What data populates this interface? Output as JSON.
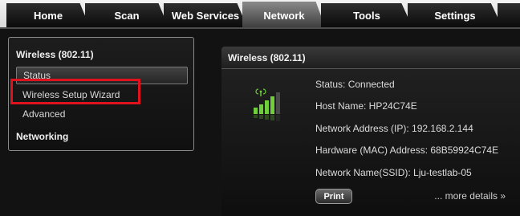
{
  "tabs": [
    {
      "label": "Home"
    },
    {
      "label": "Scan"
    },
    {
      "label": "Web Services"
    },
    {
      "label": "Network",
      "active": true
    },
    {
      "label": "Tools"
    },
    {
      "label": "Settings"
    }
  ],
  "sidebar": {
    "wireless_heading": "Wireless (802.11)",
    "items": [
      {
        "label": "Status",
        "selected": true
      },
      {
        "label": "Wireless Setup Wizard",
        "highlighted": true
      },
      {
        "label": "Advanced"
      }
    ],
    "networking_heading": "Networking"
  },
  "main": {
    "title": "Wireless (802.11)",
    "status": "Status: Connected",
    "host_name": "Host Name: HP24C74E",
    "ip_address": "Network Address (IP): 192.168.2.144",
    "mac_address": "Hardware (MAC) Address: 68B59924C74E",
    "ssid": "Network Name(SSID): Lju-testlab-05",
    "print_label": "Print",
    "more_details": "... more details »",
    "signal_icon": "wifi-signal-icon"
  },
  "colors": {
    "highlight": "#e0121e",
    "signal_green": "#6fcf3a",
    "background": "#121212"
  }
}
